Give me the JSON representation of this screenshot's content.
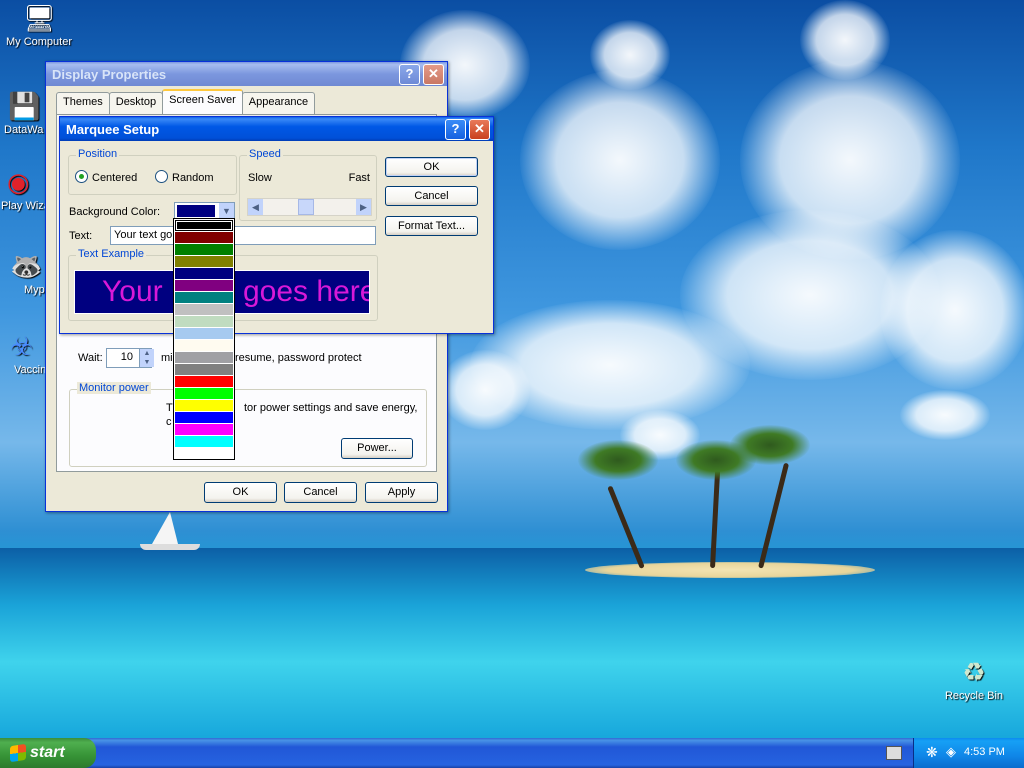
{
  "desktop": {
    "icons": [
      {
        "label": "My Computer"
      },
      {
        "label": "DataWa"
      },
      {
        "label": "Play Wiza"
      },
      {
        "label": "Myp"
      },
      {
        "label": "Vaccin"
      },
      {
        "label": "Recycle Bin"
      }
    ]
  },
  "display_properties": {
    "title": "Display Properties",
    "tabs": [
      "Themes",
      "Desktop",
      "Screen Saver",
      "Appearance"
    ],
    "active_tab": "Screen Saver",
    "wait_label": "Wait:",
    "wait_value": "10",
    "wait_suffix_1": "mi",
    "wait_suffix_2": "resume, password protect",
    "monitor_power_legend": "Monitor power",
    "monitor_power_text_1": "T",
    "monitor_power_text_2": "tor power settings and save energy,",
    "monitor_power_text_3": "c",
    "power_button": "Power...",
    "ok_button": "OK",
    "cancel_button": "Cancel",
    "apply_button": "Apply"
  },
  "marquee_setup": {
    "title": "Marquee Setup",
    "position_legend": "Position",
    "centered_label": "Centered",
    "random_label": "Random",
    "position_selected": "Centered",
    "speed_legend": "Speed",
    "slow_label": "Slow",
    "fast_label": "Fast",
    "background_color_label": "Background Color:",
    "background_color_value": "#000080",
    "text_label": "Text:",
    "text_value": "Your text goes here",
    "text_visible": "Your text go",
    "text_example_legend": "Text Example",
    "preview_left": "Your",
    "preview_right": "goes here",
    "preview_bg": "#000080",
    "preview_fg": "#d819d8",
    "ok_button": "OK",
    "cancel_button": "Cancel",
    "format_text_button": "Format Text..."
  },
  "color_dropdown": {
    "colors": [
      "#000000",
      "#800000",
      "#008000",
      "#808000",
      "#000080",
      "#800080",
      "#008080",
      "#c0c0c0",
      "#c0dcc0",
      "#a6caf0",
      "#fffbf0",
      "#a0a0a4",
      "#808080",
      "#ff0000",
      "#00ff00",
      "#ffff00",
      "#0000ff",
      "#ff00ff",
      "#00ffff",
      "#ffffff"
    ],
    "selected_index": 0
  },
  "taskbar": {
    "start_label": "start",
    "clock": "4:53 PM"
  }
}
